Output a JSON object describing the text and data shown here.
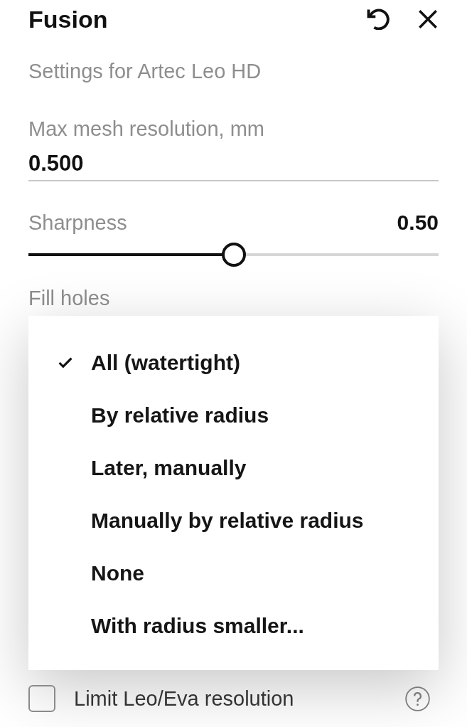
{
  "panel": {
    "title": "Fusion",
    "subtitle": "Settings for Artec Leo HD"
  },
  "mesh_resolution": {
    "label": "Max mesh resolution, mm",
    "value": "0.500"
  },
  "sharpness": {
    "label": "Sharpness",
    "reading": "0.50",
    "level": 0.5
  },
  "fill_holes": {
    "label": "Fill holes",
    "options": [
      {
        "label": "All (watertight)",
        "selected": true
      },
      {
        "label": "By relative radius",
        "selected": false
      },
      {
        "label": "Later, manually",
        "selected": false
      },
      {
        "label": "Manually by relative radius",
        "selected": false
      },
      {
        "label": "None",
        "selected": false
      },
      {
        "label": "With radius smaller...",
        "selected": false
      }
    ]
  },
  "limit_resolution": {
    "label": "Limit Leo/Eva resolution",
    "checked": false
  }
}
